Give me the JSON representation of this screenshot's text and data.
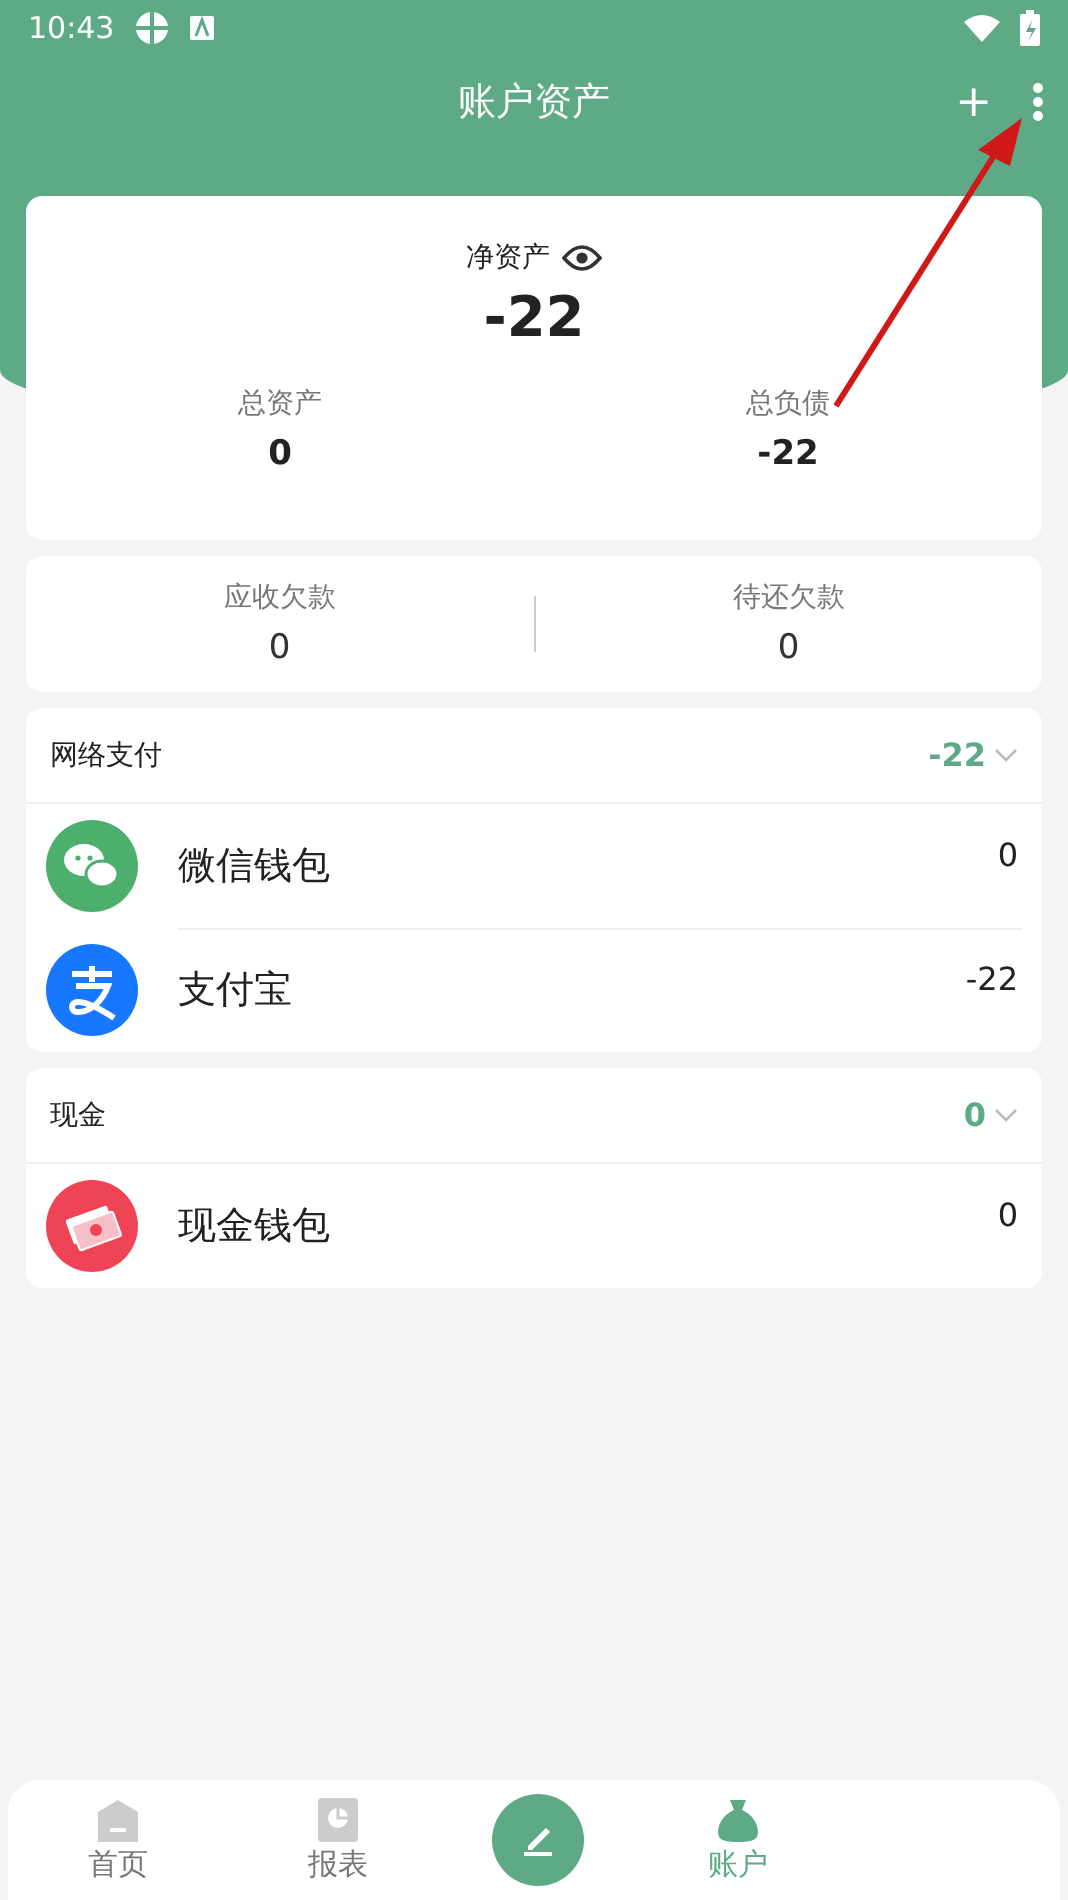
{
  "status_bar": {
    "time": "10:43"
  },
  "header": {
    "title": "账户资产",
    "add": "+"
  },
  "summary": {
    "net_label": "净资产",
    "net_value": "-22",
    "total_assets_label": "总资产",
    "total_assets": "0",
    "total_liabilities_label": "总负债",
    "total_liabilities": "-22"
  },
  "debts": [
    {
      "label": "应收欠款",
      "value": "0"
    },
    {
      "label": "待还欠款",
      "value": "0"
    }
  ],
  "groups": [
    {
      "name": "网络支付",
      "total": "-22",
      "expanded": true,
      "accounts": [
        {
          "kind": "wechat",
          "name": "微信钱包",
          "balance": "0"
        },
        {
          "kind": "alipay",
          "name": "支付宝",
          "balance": "-22"
        }
      ]
    },
    {
      "name": "现金",
      "total": "0",
      "expanded": true,
      "accounts": [
        {
          "kind": "cash",
          "name": "现金钱包",
          "balance": "0"
        }
      ]
    }
  ],
  "nav": [
    {
      "kind": "home",
      "label": "首页",
      "selected": false
    },
    {
      "kind": "report",
      "label": "报表",
      "selected": false
    },
    {
      "kind": "record"
    },
    {
      "kind": "account",
      "label": "账户",
      "selected": true
    }
  ]
}
